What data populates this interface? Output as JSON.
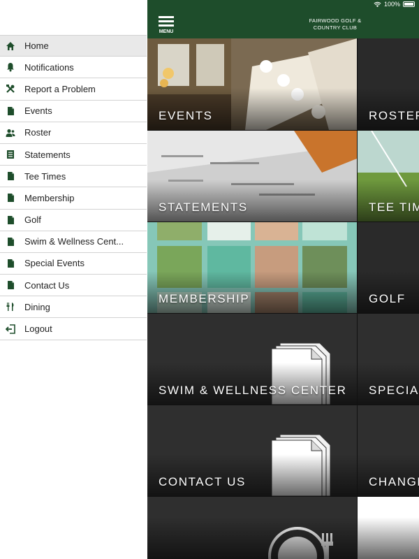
{
  "status": {
    "battery": "100%"
  },
  "appbar": {
    "menu_label": "MENU",
    "title_line1": "FAIRWOOD GOLF &",
    "title_line2": "COUNTRY CLUB"
  },
  "sidebar": {
    "items": [
      {
        "label": "Home",
        "icon": "home-icon",
        "active": true
      },
      {
        "label": "Notifications",
        "icon": "bell-icon"
      },
      {
        "label": "Report a Problem",
        "icon": "tools-icon"
      },
      {
        "label": "Events",
        "icon": "document-icon"
      },
      {
        "label": "Roster",
        "icon": "people-icon"
      },
      {
        "label": "Statements",
        "icon": "statement-icon"
      },
      {
        "label": "Tee Times",
        "icon": "document-icon"
      },
      {
        "label": "Membership",
        "icon": "document-icon"
      },
      {
        "label": "Golf",
        "icon": "document-icon"
      },
      {
        "label": "Swim & Wellness Cent...",
        "icon": "document-icon"
      },
      {
        "label": "Special Events",
        "icon": "document-icon"
      },
      {
        "label": "Contact Us",
        "icon": "document-icon"
      },
      {
        "label": "Dining",
        "icon": "utensils-icon"
      },
      {
        "label": "Logout",
        "icon": "logout-icon"
      }
    ]
  },
  "tiles": {
    "events": "EVENTS",
    "roster": "ROSTER",
    "statements": "STATEMENTS",
    "tee_times": "TEE TIM",
    "membership": "MEMBERSHIP",
    "golf": "GOLF",
    "swim": "SWIM & WELLNESS CENTER",
    "special": "SPECIAL",
    "contact": "CONTACT US",
    "change": "CHANGE"
  },
  "colors": {
    "brand_green": "#1e4d2b",
    "tile_dark": "#2f2f2f",
    "sidebar_active": "#e9e9e9"
  }
}
